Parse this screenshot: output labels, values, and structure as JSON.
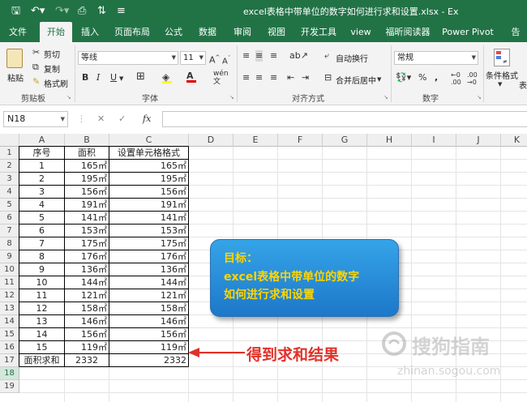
{
  "window": {
    "title": "excel表格中带单位的数字如何进行求和设置.xlsx  -  Ex"
  },
  "tabs": [
    "文件",
    "开始",
    "插入",
    "页面布局",
    "公式",
    "数据",
    "审阅",
    "视图",
    "开发工具",
    "view",
    "福昕阅读器",
    "Power Pivot",
    "告"
  ],
  "ribbon": {
    "clipboard": {
      "paste": "粘贴",
      "cut": "剪切",
      "copy": "复制",
      "format_painter": "格式刷",
      "label": "剪贴板"
    },
    "font": {
      "name": "等线",
      "size": "11",
      "bold": "B",
      "italic": "I",
      "underline": "U",
      "label": "字体"
    },
    "alignment": {
      "wrap": "自动换行",
      "merge": "合并后居中",
      "label": "对齐方式"
    },
    "number": {
      "format": "常规",
      "label": "数字"
    },
    "styles": {
      "cond_format": "条件格式",
      "table_format": "表"
    }
  },
  "formula_bar": {
    "namebox": "N18",
    "fx": "fx",
    "value": ""
  },
  "columns": [
    "A",
    "B",
    "C",
    "D",
    "E",
    "F",
    "G",
    "H",
    "I",
    "J",
    "K"
  ],
  "rows": [
    "1",
    "2",
    "3",
    "4",
    "5",
    "6",
    "7",
    "8",
    "9",
    "10",
    "11",
    "12",
    "13",
    "14",
    "15",
    "16",
    "17",
    "18",
    "19"
  ],
  "table": {
    "headers": [
      "序号",
      "面积",
      "设置单元格格式"
    ],
    "rows": [
      [
        "1",
        "165㎡",
        "165㎡"
      ],
      [
        "2",
        "195㎡",
        "195㎡"
      ],
      [
        "3",
        "156㎡",
        "156㎡"
      ],
      [
        "4",
        "191㎡",
        "191㎡"
      ],
      [
        "5",
        "141㎡",
        "141㎡"
      ],
      [
        "6",
        "153㎡",
        "153㎡"
      ],
      [
        "7",
        "175㎡",
        "175㎡"
      ],
      [
        "8",
        "176㎡",
        "176㎡"
      ],
      [
        "9",
        "136㎡",
        "136㎡"
      ],
      [
        "10",
        "144㎡",
        "144㎡"
      ],
      [
        "11",
        "121㎡",
        "121㎡"
      ],
      [
        "12",
        "158㎡",
        "158㎡"
      ],
      [
        "13",
        "146㎡",
        "146㎡"
      ],
      [
        "14",
        "156㎡",
        "156㎡"
      ],
      [
        "15",
        "119㎡",
        "119㎡"
      ]
    ],
    "total": [
      "面积求和",
      "2332",
      "2332"
    ]
  },
  "note": {
    "line1": "目标：",
    "line2": "excel表格中带单位的数字",
    "line3": "如何进行求和设置"
  },
  "annotation": "得到求和结果",
  "watermark": {
    "brand": "搜狗指南",
    "url": "zhinan.sogou.com"
  },
  "colors": {
    "excel_green": "#217346",
    "note_blue": "#1d78c9",
    "note_text": "#ffd500",
    "arrow_red": "#e0322a"
  }
}
